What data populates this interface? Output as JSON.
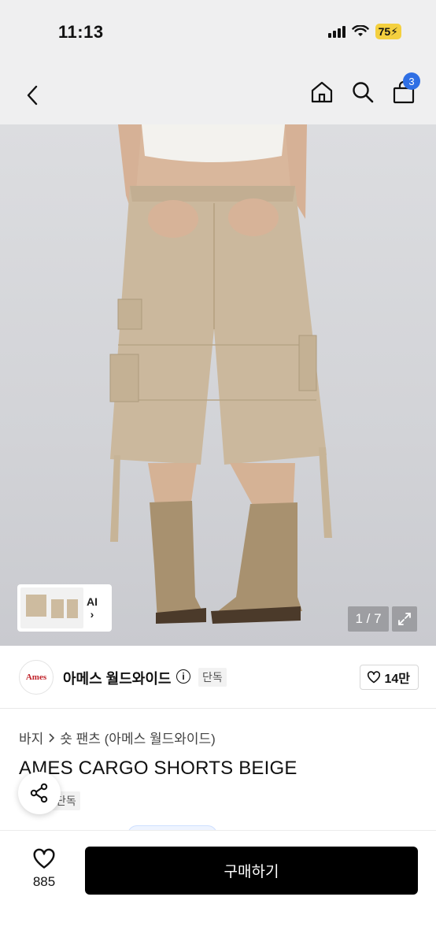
{
  "status_bar": {
    "time": "11:13",
    "battery": "75"
  },
  "header": {
    "cart_count": "3"
  },
  "gallery": {
    "counter": "1 / 7",
    "ai_label": "AI",
    "thumb_arrow": "›"
  },
  "brand": {
    "logo_text": "Ames",
    "name": "아메스 월드와이드",
    "info_glyph": "i",
    "exclusive_tag": "단독",
    "likes": "14만"
  },
  "product": {
    "breadcrumb": [
      "바지",
      "숏 팬츠 (아메스 월드와이드)"
    ],
    "title": "AMES CARGO SHORTS BEIGE",
    "exclusive_tag": "단독"
  },
  "bottom_bar": {
    "wish_count": "885",
    "buy_label": "구매하기"
  },
  "colors": {
    "accent_blue": "#2f6fe4",
    "battery_yellow": "#f4d03f",
    "buy_black": "#000000",
    "pants_beige": "#cbb89d",
    "boots_tan": "#a8916f"
  }
}
